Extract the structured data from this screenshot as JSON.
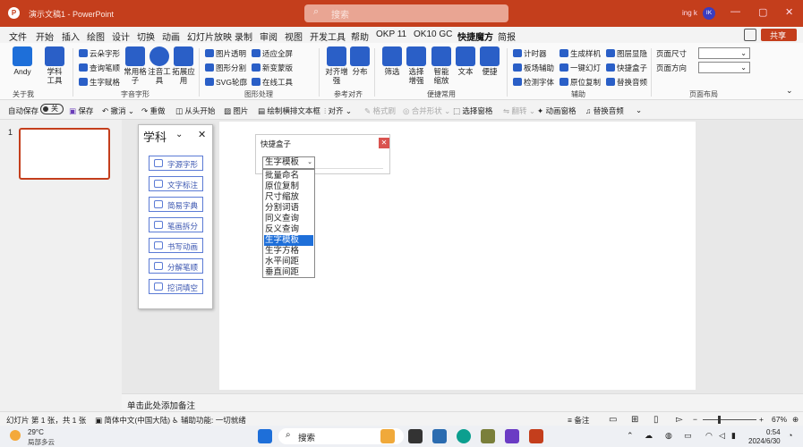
{
  "titlebar": {
    "title": "演示文稿1 - PowerPoint",
    "search_placeholder": "搜索",
    "user": "ing k",
    "avatar": "IK"
  },
  "menu": {
    "items": [
      "文件",
      "开始",
      "插入",
      "绘图",
      "设计",
      "切换",
      "动画",
      "幻灯片放映",
      "录制",
      "审阅",
      "视图",
      "开发工具",
      "帮助",
      "OKP 11",
      "OK10 GC",
      "快捷魔方",
      "简报"
    ],
    "share": "共享"
  },
  "ribbon": {
    "andy": "Andy",
    "xueke": "学科\n工具",
    "yunduo": "云朵字形",
    "chaxun": "查询笔顺",
    "shengzi": "生字赋格",
    "changyong": "常用格\n子",
    "zhuyin": "注音工\n具",
    "tuozhan": "拓展应\n用",
    "tupian_touming": "图片透明",
    "tuxing_fenge": "图形分割",
    "svg": "SVG轮廓",
    "shiying": "适应全屏",
    "xinbian": "新变蒙版",
    "zaixian": "在线工具",
    "duiqi": "对齐增\n强",
    "fenbu": "分布",
    "shaixuan": "筛选",
    "xuanze": "选择\n增强",
    "zhineng": "智能\n缩放",
    "wenben": "文本",
    "bianjie": "便捷",
    "jishiqi": "计时器",
    "banshi": "板场辅助",
    "jiance": "检测字体",
    "shengcheng": "生成样机",
    "yijian": "一键幻灯",
    "yuanwei": "原位复制",
    "tuceng": "图层显隐",
    "kuaijie": "快捷盒子",
    "tihuan": "替换音频",
    "page_size": "页面尺寸",
    "page_dir": "页面方向",
    "groups": [
      "关于我",
      "字音字形",
      "图形处理",
      "参考对齐",
      "便捷常用",
      "辅助",
      "页面布局"
    ]
  },
  "qat": {
    "autosave": "自动保存",
    "off": "关",
    "save": "保存",
    "undo": "撤消",
    "redo": "重做",
    "from_start": "从头开始",
    "picture": "图片",
    "draw_text": "绘制横排文本框",
    "align": "对齐",
    "format_brush": "格式刷",
    "merge": "合并形状",
    "select_pane": "选择窗格",
    "flip": "翻转",
    "anim_pane": "动画窗格",
    "replace_audio": "替换音频"
  },
  "slide_panel": {
    "number": "1"
  },
  "xueke_panel": {
    "title": "学科",
    "buttons": [
      "字源字形",
      "文字标注",
      "简易字典",
      "笔画拆分",
      "书写动画",
      "分解笔顺",
      "挖词填空"
    ]
  },
  "dialog": {
    "title": "快捷盒子",
    "selected": "生字模板",
    "options": [
      "批量命名",
      "原位复制",
      "尺寸缩放",
      "分割词语",
      "同义查询",
      "反义查询",
      "生字模板",
      "生字方格",
      "水平间距",
      "垂直间距"
    ],
    "selected_index": 6
  },
  "notes": {
    "placeholder": "单击此处添加备注"
  },
  "status": {
    "slide": "幻灯片 第 1 张，共 1 张",
    "lang": "简体中文(中国大陆)",
    "access": "辅助功能: 一切就绪",
    "notes": "备注",
    "zoom": "67%"
  },
  "taskbar": {
    "temp": "29°C",
    "weather": "局部多云",
    "search": "搜索",
    "time": "0:54",
    "date": "2024/6/30"
  },
  "colors": {
    "accent": "#c43e1c",
    "link": "#1e6fd9",
    "panel": "#5b7bd5"
  }
}
